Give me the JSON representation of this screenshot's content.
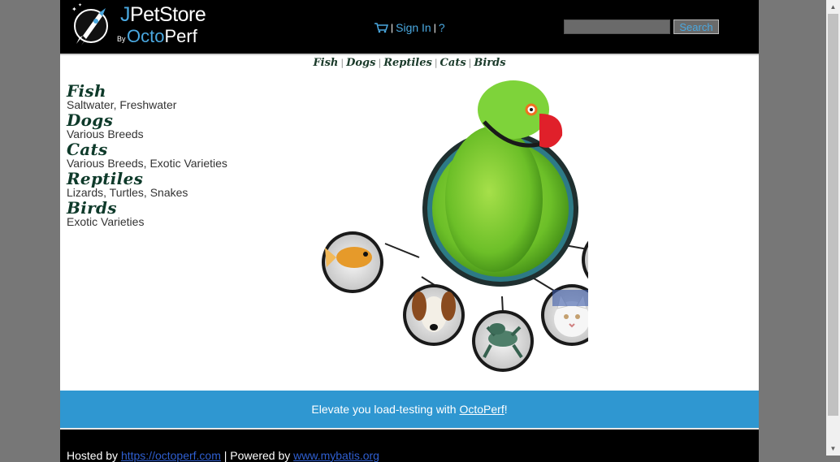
{
  "header": {
    "logo_top_j": "J",
    "logo_top_rest": "PetStore",
    "logo_by": "By",
    "logo_bottom_octo": "Octo",
    "logo_bottom_perf": "Perf",
    "sign_in": "Sign In",
    "help": "?",
    "search_value": "",
    "search_button": "Search"
  },
  "quicklinks": [
    "Fish",
    "Dogs",
    "Reptiles",
    "Cats",
    "Birds"
  ],
  "sidebar": [
    {
      "title": "Fish",
      "desc": "Saltwater, Freshwater"
    },
    {
      "title": "Dogs",
      "desc": "Various Breeds"
    },
    {
      "title": "Cats",
      "desc": "Various Breeds, Exotic Varieties"
    },
    {
      "title": "Reptiles",
      "desc": "Lizards, Turtles, Snakes"
    },
    {
      "title": "Birds",
      "desc": "Exotic Varieties"
    }
  ],
  "banner": {
    "prefix": "Elevate you load-testing with ",
    "link": "OctoPerf",
    "suffix": "!"
  },
  "footer": {
    "hosted_by": "Hosted by ",
    "hosted_link": "https://octoperf.com",
    "powered_by": " | Powered by ",
    "powered_link": "www.mybatis.org"
  },
  "colors": {
    "header_bg": "#000000",
    "accent": "#4aa8e0",
    "banner_bg": "#2f97d1",
    "page_bg": "#777777"
  },
  "icons": [
    "rocket-logo-icon",
    "cart-icon",
    "parrot-image",
    "fish-image",
    "dog-image",
    "reptile-image",
    "cat-image",
    "macaw-image"
  ]
}
